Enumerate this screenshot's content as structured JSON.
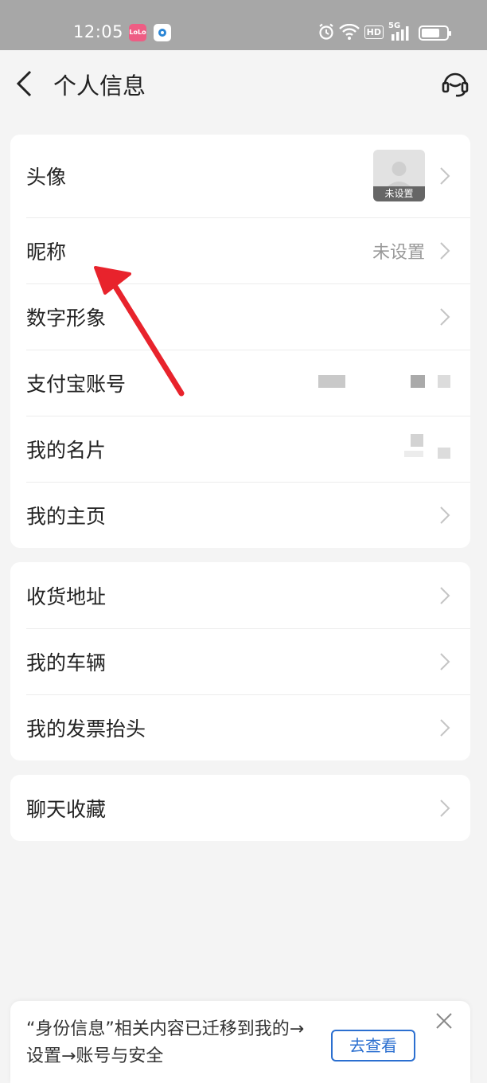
{
  "status_bar": {
    "time": "12:05",
    "badge_app": "LoLo",
    "network": "HD",
    "signal_label": "5G"
  },
  "nav": {
    "title": "个人信息",
    "back_icon": "chevron-left-icon",
    "service_icon": "headset-icon"
  },
  "section_profile": {
    "items": [
      {
        "label": "头像",
        "avatar_label": "未设置"
      },
      {
        "label": "昵称",
        "value": "未设置"
      },
      {
        "label": "数字形象"
      },
      {
        "label": "支付宝账号"
      },
      {
        "label": "我的名片"
      },
      {
        "label": "我的主页"
      }
    ]
  },
  "section_life": {
    "items": [
      {
        "label": "收货地址"
      },
      {
        "label": "我的车辆"
      },
      {
        "label": "我的发票抬头"
      }
    ]
  },
  "section_chat": {
    "items": [
      {
        "label": "聊天收藏"
      }
    ]
  },
  "banner": {
    "text": "“身份信息”相关内容已迁移到我的→设置→账号与安全",
    "button_label": "去查看",
    "close_icon": "close-icon"
  },
  "colors": {
    "accent": "#2b6fd0",
    "annotation_arrow": "#e8232c",
    "status_bar": "#a7a7a7",
    "background": "#f4f4f4"
  }
}
